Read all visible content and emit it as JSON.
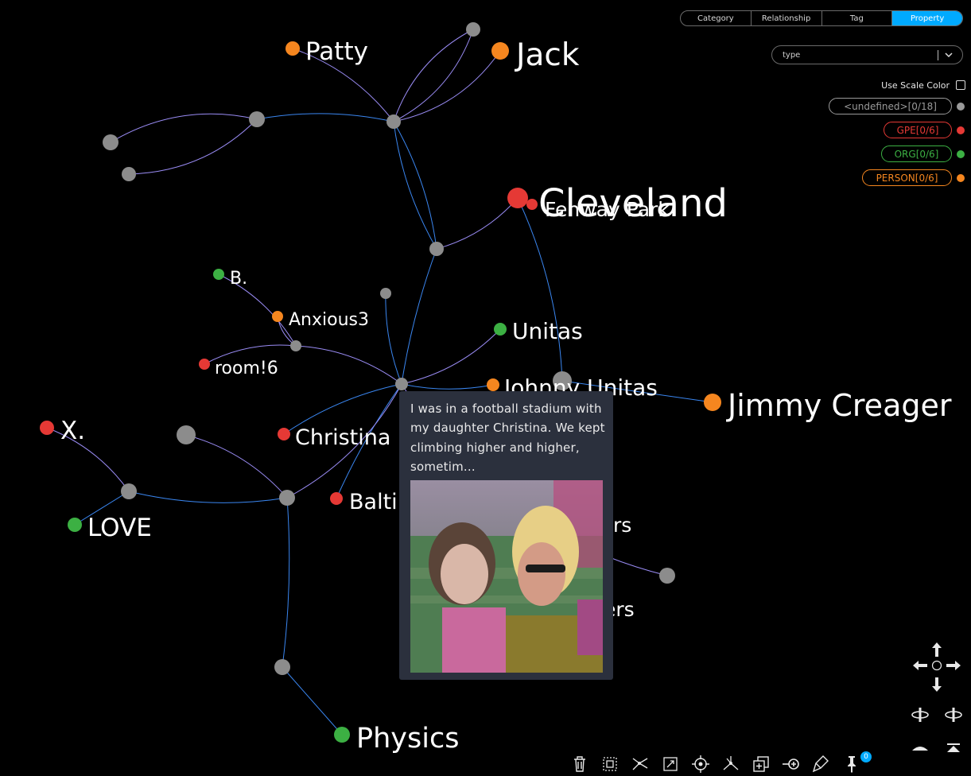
{
  "tabs": [
    "Category",
    "Relationship",
    "Tag",
    "Property"
  ],
  "active_tab": "Property",
  "property_select": {
    "value": "type"
  },
  "scale_color": {
    "label": "Use Scale Color",
    "checked": false
  },
  "legend": [
    {
      "label": "<undefined>[0/18]",
      "color": "#9a9a9a"
    },
    {
      "label": "GPE[0/6]",
      "color": "#e53935"
    },
    {
      "label": "ORG[0/6]",
      "color": "#3cb043"
    },
    {
      "label": "PERSON[0/6]",
      "color": "#f5861f"
    }
  ],
  "node_labels": {
    "patty": "Patty",
    "jack": "Jack",
    "cleveland": "Cleveland",
    "fenway": "Fenway Park",
    "b": "B.",
    "anxious3": "Anxious3",
    "room6": "room!6",
    "unitas": "Unitas",
    "johnny": "Johnny Unitas",
    "jimmy": "Jimmy Creager",
    "x": "X.",
    "christina": "Christina",
    "baltimore": "Baltimore",
    "love": "LOVE",
    "physics": "Physics",
    "partial1": "rs",
    "partial2": "ers"
  },
  "tooltip": {
    "text": "I was in a football stadium with my daughter Christina. We kept climbing higher and higher, sometim...",
    "image": "stadium-photo"
  },
  "pin_count": "0",
  "icons": {
    "nav": [
      "arrow-up-icon",
      "arrow-left-icon",
      "center-icon",
      "arrow-right-icon",
      "arrow-down-icon",
      "rotate-left-icon",
      "rotate-right-icon",
      "tilt-down-icon",
      "tilt-up-icon"
    ],
    "toolbar": [
      "trash-icon",
      "select-box-icon",
      "expand-icon",
      "fit-view-icon",
      "target-icon",
      "layout-icon",
      "copy-icon",
      "add-link-icon",
      "clear-icon",
      "pin-icon"
    ]
  }
}
